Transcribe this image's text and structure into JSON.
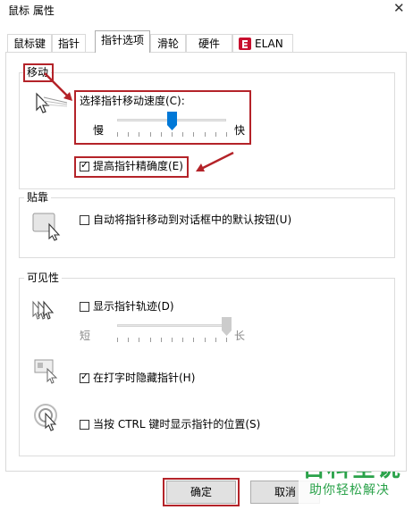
{
  "window": {
    "title": "鼠标 属性",
    "close_label": "✕"
  },
  "tabs": [
    {
      "label": "鼠标键"
    },
    {
      "label": "指针"
    },
    {
      "label": "指针选项",
      "active": true
    },
    {
      "label": "滑轮"
    },
    {
      "label": "硬件"
    },
    {
      "label": "ELAN"
    }
  ],
  "motion": {
    "group_label": "移动",
    "speed_label": "选择指针移动速度(C):",
    "slow_label": "慢",
    "fast_label": "快",
    "speed_level": 0.5,
    "enhance_precision_label": "提高指针精确度(E)",
    "enhance_precision_checked": true
  },
  "snap_to": {
    "group_label": "贴靠",
    "snap_label": "自动将指针移动到对话框中的默认按钮(U)",
    "snap_checked": false
  },
  "visibility": {
    "group_label": "可见性",
    "trails_label": "显示指针轨迹(D)",
    "trails_checked": false,
    "short_label": "短",
    "long_label": "长",
    "trail_level": 1.0,
    "hide_typing_label": "在打字时隐藏指针(H)",
    "hide_typing_checked": true,
    "ctrl_locate_label": "当按 CTRL 键时显示指针的位置(S)",
    "ctrl_locate_checked": false
  },
  "buttons": {
    "ok": "确定",
    "cancel": "取消"
  },
  "watermark": {
    "line1": "百科全说",
    "line2": "助你轻松解决"
  },
  "colors": {
    "annotation_red": "#b42329",
    "slider_thumb": "#0078d7",
    "watermark_green": "#2aa24a"
  }
}
